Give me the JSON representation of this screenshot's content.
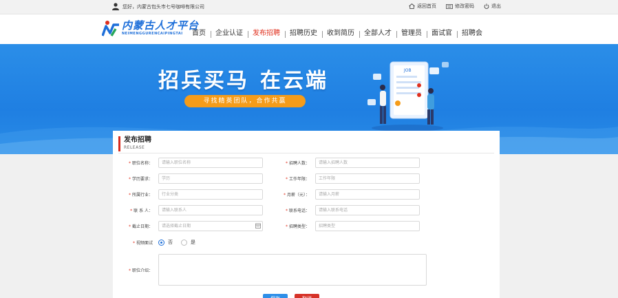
{
  "topbar": {
    "greeting": "您好，内蒙古包头市七号咖啡有限公司",
    "links": [
      {
        "label": "返回首页",
        "icon": "home-icon"
      },
      {
        "label": "修改密码",
        "icon": "keyboard-icon"
      },
      {
        "label": "退出",
        "icon": "power-icon"
      }
    ]
  },
  "logo": {
    "main": "内蒙古人才平台",
    "sub": "NEIMENGGURENCAIPINGTAI"
  },
  "nav": [
    {
      "label": "首页",
      "active": false
    },
    {
      "label": "企业认证",
      "active": false
    },
    {
      "label": "发布招聘",
      "active": true
    },
    {
      "label": "招聘历史",
      "active": false
    },
    {
      "label": "收到简历",
      "active": false
    },
    {
      "label": "全部人才",
      "active": false
    },
    {
      "label": "管理员",
      "active": false
    },
    {
      "label": "面试官",
      "active": false
    },
    {
      "label": "招聘会",
      "active": false
    }
  ],
  "banner": {
    "slogan_left": "招兵买马",
    "slogan_right": "在云端",
    "pill": "寻找精英团队，合作共赢",
    "job_tag": "JOB"
  },
  "form": {
    "title": "发布招聘",
    "subtitle": "RELEASE",
    "fields": {
      "position_name": {
        "label": "职位名称：",
        "placeholder": "请输入职位名称"
      },
      "headcount": {
        "label": "招聘人数：",
        "placeholder": "请输入招聘人数"
      },
      "education": {
        "label": "学历要求：",
        "placeholder": "学历"
      },
      "experience": {
        "label": "工作年限：",
        "placeholder": "工作年限"
      },
      "industry": {
        "label": "所属行业：",
        "placeholder": "行业分类"
      },
      "salary": {
        "label": "月薪（元）：",
        "placeholder": "请输入月薪"
      },
      "contact": {
        "label": "联 系 人：",
        "placeholder": "请输入联系人"
      },
      "phone": {
        "label": "联系电话：",
        "placeholder": "请输入联系电话"
      },
      "deadline": {
        "label": "截止日期：",
        "placeholder": "请选择截止日期"
      },
      "recruit_type": {
        "label": "招聘类型：",
        "placeholder": "招聘类型"
      },
      "video_interview": {
        "label": "视频面试",
        "options": [
          "否",
          "是"
        ],
        "selected": "否"
      },
      "description": {
        "label": "职位介绍："
      }
    },
    "buttons": {
      "save": "保存",
      "cancel": "取消"
    }
  },
  "colors": {
    "accent": "#1e6fd9",
    "active_nav": "#e0301e",
    "banner": "#2b8ee8",
    "pill": "#f59c1a"
  }
}
